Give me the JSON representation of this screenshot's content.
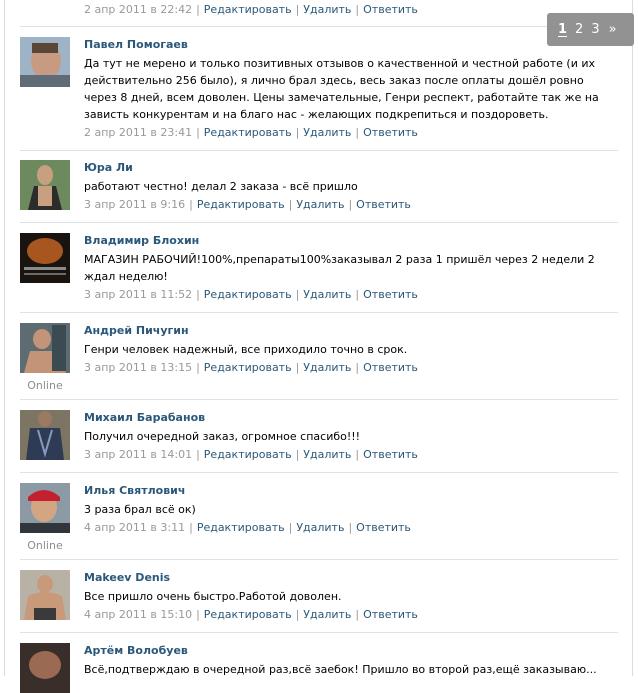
{
  "pager": {
    "pages": [
      "1",
      "2",
      "3"
    ],
    "next": "»",
    "current": "1"
  },
  "actions": {
    "edit": "Редактировать",
    "delete": "Удалить",
    "reply": "Ответить"
  },
  "top_meta": {
    "date": "2 апр 2011 в 22:42"
  },
  "posts": [
    {
      "author": "Павел Помогаев",
      "text": "Да тут не мерено и только позитивных отзывов о качественной и честной работе (и их действительно 256 было), я лично брал здесь, весь заказ после оплаты дошёл ровно через 8 дней, всем доволен. Цены замечательные, Генри респект, работайте так же на зависть конкурентам и на благо нас - желающих подкрепиться и поздороветь.",
      "date": "2 апр 2011 в 23:41",
      "online": ""
    },
    {
      "author": "Юра Ли",
      "text": "работают честно! делал 2 заказа - всё пришло",
      "date": "3 апр 2011 в 9:16",
      "online": ""
    },
    {
      "author": "Владимир Блохин",
      "text": "МАГАЗИН РАБОЧИЙ!100%,препараты100%заказывал 2 раза 1 пришёл через 2 недели 2 ждал неделю!",
      "date": "3 апр 2011 в 11:52",
      "online": ""
    },
    {
      "author": "Андрей Пичугин",
      "text": "Генри человек надежный, все приходило точно в срок.",
      "date": "3 апр 2011 в 13:15",
      "online": "Online"
    },
    {
      "author": "Михаил Барабанов",
      "text": "Получил очередной заказ, огромное спасибо!!!",
      "date": "3 апр 2011 в 14:01",
      "online": ""
    },
    {
      "author": "Илья Святлович",
      "text": "3 раза брал всё ок)",
      "date": "4 апр 2011 в 3:11",
      "online": "Online"
    },
    {
      "author": "Makeev Denis",
      "text": "Все пришло очень быстро.Работой доволен.",
      "date": "4 апр 2011 в 15:10",
      "online": ""
    },
    {
      "author": "Артём Волобуев",
      "text": "Всё,подтверждаю в очередной раз,всё заебок! Пришло во второй раз,ещё заказываю...",
      "date": "",
      "online": ""
    }
  ],
  "colors": {
    "link": "#2b587a",
    "meta": "#999999",
    "divider": "#dde3e9",
    "pager_bg": "#8d8d8d"
  }
}
